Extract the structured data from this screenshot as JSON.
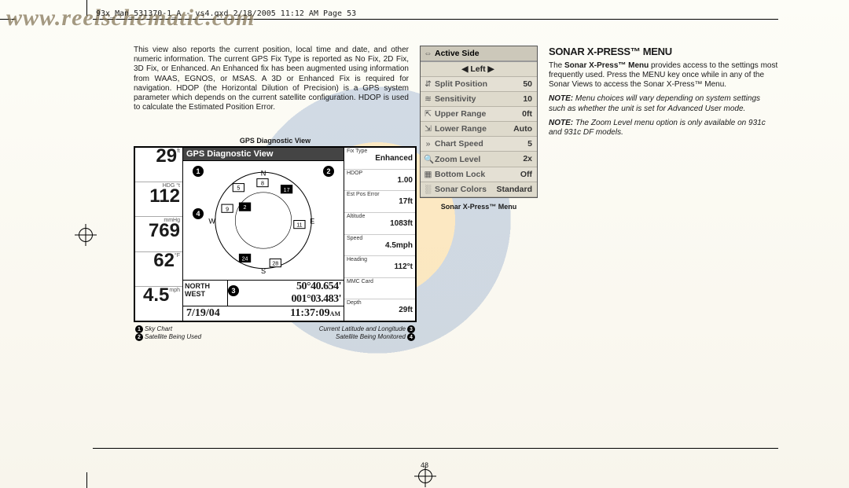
{
  "header_label": "93x_Man_531370-1_A - vs4.qxd  2/18/2005  11:12 AM  Page 53",
  "watermark": "www.reelschematic.com",
  "page_number": "48",
  "para1": "This view also reports the current position, local time and date, and other numeric information. The current GPS Fix Type is reported as No Fix, 2D Fix, 3D Fix, or Enhanced. An Enhanced fix has been augmented using information from WAAS, EGNOS, or MSAS. A 3D or Enhanced Fix is required for navigation. HDOP (the Horizontal Dilution of Precision) is a GPS system parameter which depends on the current satellite configuration. HDOP is used to calculate the Estimated Position Error.",
  "fig1": {
    "caption": "GPS Diagnostic View",
    "title": "GPS Diagnostic View",
    "left_vals": [
      {
        "unit": "ft",
        "big": "29"
      },
      {
        "unit": "HDG     °t",
        "big": "112"
      },
      {
        "unit": "mmHg",
        "big": "769"
      },
      {
        "unit": "°F",
        "big": "62"
      },
      {
        "unit": "mph",
        "big": "4.5"
      }
    ],
    "coords_n_lab": "NORTH",
    "coords_w_lab": "WEST",
    "coords_n": "50°40.654'",
    "coords_w": "001°03.483'",
    "date": "7/19/04",
    "time": "11:37:09",
    "ampm": "AM",
    "right_rows": [
      {
        "lbl": "Fix Type",
        "v": "Enhanced"
      },
      {
        "lbl": "HDOP",
        "v": "1.00"
      },
      {
        "lbl": "Est Pos Error",
        "v": "17ft"
      },
      {
        "lbl": "Altitude",
        "v": "1083ft"
      },
      {
        "lbl": "Speed",
        "v": "4.5mph"
      },
      {
        "lbl": "Heading",
        "v": "112°t"
      },
      {
        "lbl": "MMC Card",
        "v": ""
      },
      {
        "lbl": "Depth",
        "v": "29ft"
      }
    ],
    "callouts": {
      "l1": "Sky Chart",
      "l2": "Satellite Being Used",
      "r1": "Current Latitude and Longitude",
      "r2": "Satellite Being Monitored"
    }
  },
  "sonar_menu": {
    "caption": "Sonar X-Press™ Menu",
    "rows": [
      {
        "icon": "⇔",
        "label": "Active Side",
        "hdr": true
      },
      {
        "icon": "",
        "label": "◀   Left   ▶",
        "center": true
      },
      {
        "icon": "⇵",
        "label": "Split Position",
        "value": "50"
      },
      {
        "icon": "≋",
        "label": "Sensitivity",
        "value": "10"
      },
      {
        "icon": "⇱",
        "label": "Upper Range",
        "value": "0ft"
      },
      {
        "icon": "⇲",
        "label": "Lower Range",
        "value": "Auto"
      },
      {
        "icon": "»",
        "label": "Chart Speed",
        "value": "5"
      },
      {
        "icon": "🔍",
        "label": "Zoom Level",
        "value": "2x"
      },
      {
        "icon": "▦",
        "label": "Bottom Lock",
        "value": "Off"
      },
      {
        "icon": "░",
        "label": "Sonar Colors",
        "value": "Standard"
      }
    ]
  },
  "right_col": {
    "heading": "SONAR X-PRESS™ MENU",
    "bold_lead": "Sonar X-Press™ Menu",
    "body": " provides access to the settings most frequently used. Press the MENU key once while in any of the Sonar Views to access the Sonar X-Press™ Menu.",
    "note1_lbl": "NOTE:",
    "note1": " Menu choices will vary depending on system settings such as whether the unit is set for Advanced User mode.",
    "note2_lbl": "NOTE:",
    "note2": " The Zoom Level menu option is only available on 931c and 931c DF models."
  }
}
